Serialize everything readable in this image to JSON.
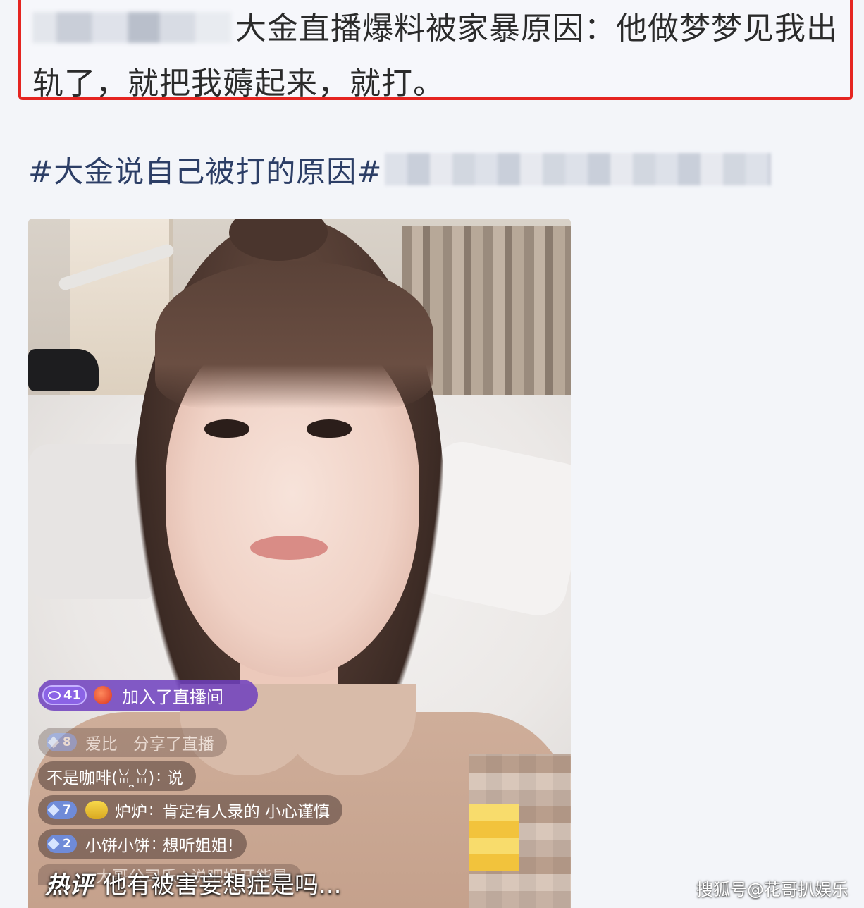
{
  "post": {
    "text": "大金直播爆料被家暴原因：他做梦梦见我出轨了，就把我薅起来，就打。"
  },
  "hashtag": {
    "text": "#大金说自己被打的原因#"
  },
  "live": {
    "join": {
      "level": "41",
      "text": "加入了直播间"
    },
    "messages": [
      {
        "badge": "8",
        "user": "爱比",
        "sep": "",
        "text": "分享了直播"
      },
      {
        "badge": "",
        "user": "不是咖啡(ꈍ ̯ꈍ)",
        "sep": ":",
        "text": "说"
      },
      {
        "badge": "7",
        "user": "炉炉",
        "sep": ":",
        "text": "肯定有人录的 小心谨慎"
      },
      {
        "badge": "2",
        "user": "小饼小饼",
        "sep": ":",
        "text": "想听姐姐!"
      },
      {
        "badge": "",
        "user": "大哥公司乐",
        "sep": ":",
        "text": "说吧姐开能是"
      }
    ],
    "hot_comment": {
      "tag": "热评",
      "text": "他有被害妄想症是吗..."
    }
  },
  "watermark": "搜狐号@花哥扒娱乐",
  "colors": {
    "highlight_border": "#e52521",
    "hashtag": "#2c3e66",
    "join_pill": "#6e40be"
  }
}
